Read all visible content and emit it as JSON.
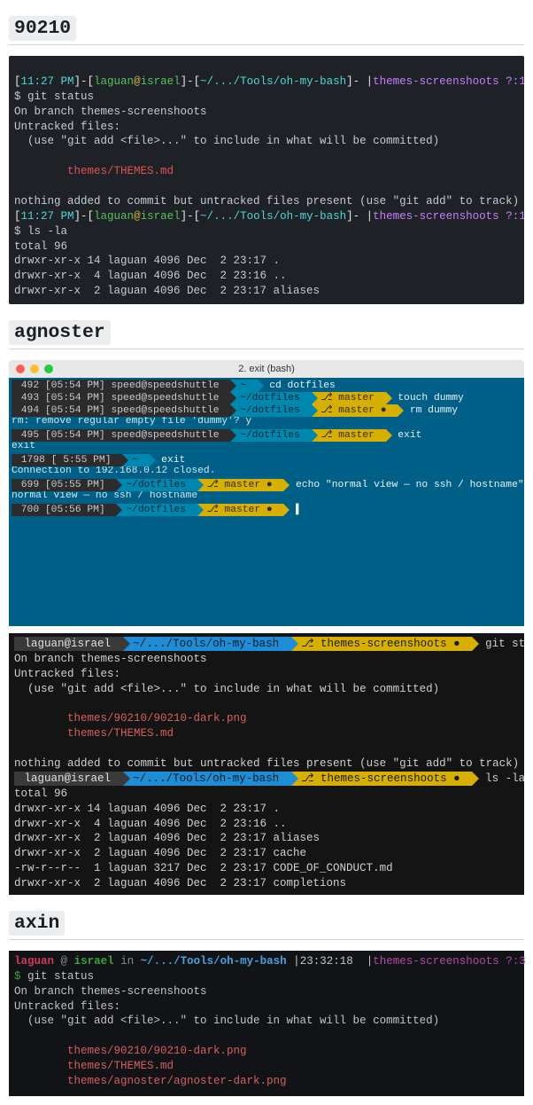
{
  "themes": {
    "t0": {
      "name": "90210"
    },
    "t1": {
      "name": "agnoster"
    },
    "t2": {
      "name": "axin"
    }
  },
  "zip": {
    "prompt_time": "11:27 PM",
    "user": "laguan",
    "host": "israel",
    "cwd": "~/.../Tools/oh-my-bash",
    "branch": "themes-screenshoots",
    "status_tag": "?:1",
    "status_x": "✗",
    "lines1": [
      "$ git status",
      "On branch themes-screenshoots",
      "Untracked files:",
      "  (use \"git add <file>...\" to include in what will be committed)",
      "",
      "        themes/THEMES.md",
      "",
      "nothing added to commit but untracked files present (use \"git add\" to track)"
    ],
    "file1": "themes/THEMES.md",
    "lines2": [
      "$ ls -la",
      "total 96",
      "drwxr-xr-x 14 laguan 4096 Dec  2 23:17 .",
      "drwxr-xr-x  4 laguan 4096 Dec  2 23:16 ..",
      "drwxr-xr-x  2 laguan 4096 Dec  2 23:17 aliases"
    ]
  },
  "mac": {
    "title": "2. exit (bash)"
  },
  "ag": {
    "rows": [
      {
        "n": "492",
        "t": "[05:54 PM]",
        "h": "speed@speedshuttle",
        "home": "~",
        "path": "",
        "branch": "",
        "dirty": "",
        "cmd": "cd dotfiles"
      },
      {
        "n": "493",
        "t": "[05:54 PM]",
        "h": "speed@speedshuttle",
        "home": "",
        "path": "~/dotfiles",
        "branch": "master",
        "dirty": "",
        "cmd": "touch dummy"
      },
      {
        "n": "494",
        "t": "[05:54 PM]",
        "h": "speed@speedshuttle",
        "home": "",
        "path": "~/dotfiles",
        "branch": "master",
        "dirty": "●",
        "cmd": "rm dummy"
      }
    ],
    "rm_prompt": "rm: remove regular empty file 'dummy'? y",
    "row4": {
      "n": "495",
      "t": "[05:54 PM]",
      "h": "speed@speedshuttle",
      "path": "~/dotfiles",
      "branch": "master",
      "cmd": "exit"
    },
    "exit": "exit",
    "row5": {
      "n": "1798",
      "t": "[ 5:55 PM]",
      "home": "~",
      "cmd": "exit"
    },
    "closed": "Connection to 192.168.0.12 closed.",
    "row6": {
      "n": "699",
      "t": "[05:55 PM]",
      "path": "~/dotfiles",
      "branch": "master",
      "dirty": "●",
      "cmd": "echo \"normal view — no ssh / hostname\""
    },
    "echoout": "normal view — no ssh / hostname",
    "row7": {
      "n": "700",
      "t": "[05:56 PM]",
      "path": "~/dotfiles",
      "branch": "master",
      "dirty": "●",
      "cmd": "▌"
    }
  },
  "ag2": {
    "userhost": "laguan@israel",
    "cwd": "~/.../Tools/oh-my-bash",
    "branch": "themes-screenshoots",
    "dot": "●",
    "cmd1": "git status",
    "out1": [
      "On branch themes-screenshoots",
      "Untracked files:",
      "  (use \"git add <file>...\" to include in what will be committed)",
      ""
    ],
    "files": [
      "themes/90210/90210-dark.png",
      "themes/THEMES.md"
    ],
    "out2": "nothing added to commit but untracked files present (use \"git add\" to track)",
    "cmd2": "ls -la",
    "ls": [
      "total 96",
      "drwxr-xr-x 14 laguan 4096 Dec  2 23:17 .",
      "drwxr-xr-x  4 laguan 4096 Dec  2 23:16 ..",
      "drwxr-xr-x  2 laguan 4096 Dec  2 23:17 aliases",
      "drwxr-xr-x  2 laguan 4096 Dec  2 23:17 cache",
      "-rw-r--r--  1 laguan 3217 Dec  2 23:17 CODE_OF_CONDUCT.md",
      "drwxr-xr-x  2 laguan 4096 Dec  2 23:17 completions"
    ]
  },
  "axin": {
    "user": "laguan",
    "at": "@",
    "host": "israel",
    "in": "in",
    "path": "~/.../Tools/oh-my-bash",
    "time": "23:32:18",
    "branch": "themes-screenshoots",
    "q": "?:3",
    "x": "✗",
    "ps": "$",
    "cmd": "git status",
    "out": [
      "On branch themes-screenshoots",
      "Untracked files:",
      "  (use \"git add <file>...\" to include in what will be committed)",
      ""
    ],
    "files": [
      "themes/90210/90210-dark.png",
      "themes/THEMES.md",
      "themes/agnoster/agnoster-dark.png"
    ]
  }
}
